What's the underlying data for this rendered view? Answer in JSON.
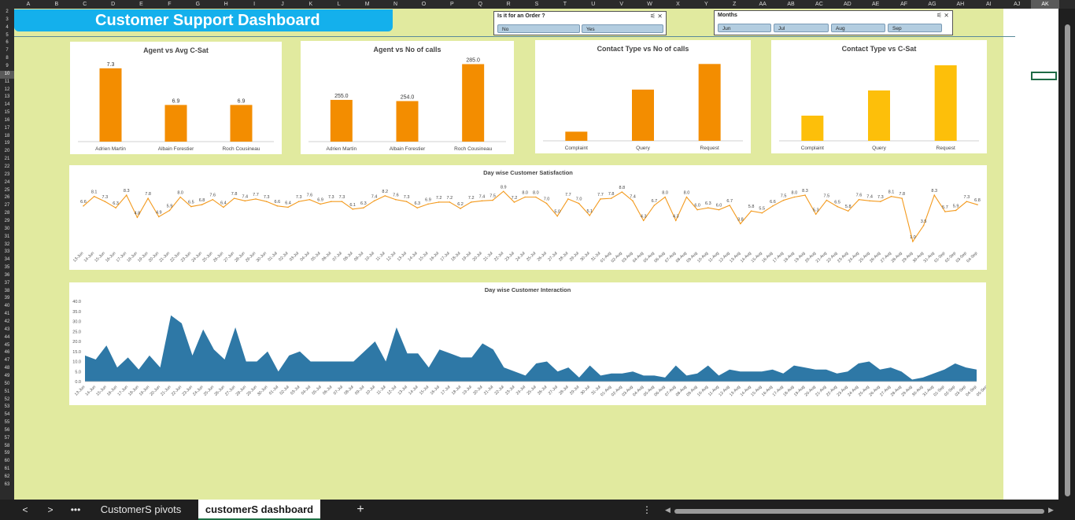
{
  "column_headers": [
    "A",
    "B",
    "C",
    "D",
    "E",
    "F",
    "G",
    "H",
    "I",
    "J",
    "K",
    "L",
    "M",
    "N",
    "O",
    "P",
    "Q",
    "R",
    "S",
    "T",
    "U",
    "V",
    "W",
    "X",
    "Y",
    "Z",
    "AA",
    "AB",
    "AC",
    "AD",
    "AE",
    "AF",
    "AG",
    "AH",
    "AI",
    "AJ",
    "AK"
  ],
  "selected_column": "AK",
  "row_headers": [
    "2",
    "3",
    "4",
    "5",
    "6",
    "7",
    "8",
    "9",
    "10",
    "11",
    "12",
    "13",
    "14",
    "15",
    "16",
    "17",
    "18",
    "19",
    "20",
    "21",
    "22",
    "23",
    "24",
    "25",
    "26",
    "27",
    "28",
    "29",
    "30",
    "31",
    "32",
    "33",
    "34",
    "35",
    "36",
    "37",
    "38",
    "39",
    "40",
    "41",
    "42",
    "43",
    "44",
    "45",
    "46",
    "47",
    "48",
    "49",
    "50",
    "51",
    "52",
    "53",
    "54",
    "55",
    "56",
    "57",
    "58",
    "59",
    "60",
    "61",
    "62",
    "63"
  ],
  "selected_row": "10",
  "dashboard": {
    "title": "Customer Support Dashboard"
  },
  "slicers": {
    "order": {
      "title": "Is it for an Order ?",
      "items": [
        "No",
        "Yes"
      ]
    },
    "months": {
      "title": "Months",
      "items": [
        "Jun",
        "Jul",
        "Aug",
        "Sep"
      ]
    }
  },
  "colors": {
    "sheet_bg": "#e1ea9f",
    "banner": "#14b0ec",
    "orange": "#f38d00",
    "yellow": "#fdbf0a",
    "area": "#2e78a6",
    "line": "#f39a1e"
  },
  "chart_data": [
    {
      "id": "agent-csat",
      "type": "bar",
      "title": "Agent vs Avg C-Sat",
      "categories": [
        "Adrien Martin",
        "Albain Forestier",
        "Roch Cousineau"
      ],
      "values": [
        7.3,
        6.9,
        6.9
      ],
      "labels": [
        "7.3",
        "6.9",
        "6.9"
      ],
      "ylim": [
        6.5,
        7.35
      ],
      "color": "#f38d00",
      "show_labels": true
    },
    {
      "id": "agent-calls",
      "type": "bar",
      "title": "Agent vs No of calls",
      "categories": [
        "Adrien Martin",
        "Albain Forestier",
        "Roch Cousineau"
      ],
      "values": [
        255,
        254,
        285
      ],
      "labels": [
        "255.0",
        "254.0",
        "285.0"
      ],
      "ylim": [
        220,
        286
      ],
      "color": "#f38d00",
      "show_labels": true
    },
    {
      "id": "contact-calls",
      "type": "bar",
      "title": "Contact Type vs No of calls",
      "categories": [
        "Complaint",
        "Query",
        "Request"
      ],
      "values": [
        120,
        350,
        490
      ],
      "labels": [],
      "ylim": [
        70,
        500
      ],
      "color": "#f38d00",
      "show_labels": false
    },
    {
      "id": "contact-csat",
      "type": "bar",
      "title": "Contact Type vs C-Sat",
      "categories": [
        "Complaint",
        "Query",
        "Request"
      ],
      "values": [
        6.6,
        7.0,
        7.4
      ],
      "labels": [],
      "ylim": [
        6.2,
        7.45
      ],
      "color": "#fdbf0a",
      "show_labels": false
    },
    {
      "id": "daily-csat",
      "type": "line",
      "title": "Day wise Customer Satisfaction",
      "categories": [
        "13-Jun",
        "14-Jun",
        "15-Jun",
        "16-Jun",
        "17-Jun",
        "18-Jun",
        "19-Jun",
        "20-Jun",
        "21-Jun",
        "22-Jun",
        "23-Jun",
        "24-Jun",
        "25-Jun",
        "26-Jun",
        "27-Jun",
        "28-Jun",
        "29-Jun",
        "30-Jun",
        "01-Jul",
        "02-Jul",
        "03-Jul",
        "04-Jul",
        "05-Jul",
        "06-Jul",
        "07-Jul",
        "08-Jul",
        "09-Jul",
        "10-Jul",
        "11-Jul",
        "12-Jul",
        "13-Jul",
        "14-Jul",
        "15-Jul",
        "16-Jul",
        "17-Jul",
        "18-Jul",
        "19-Jul",
        "20-Jul",
        "21-Jul",
        "22-Jul",
        "23-Jul",
        "24-Jul",
        "25-Jul",
        "26-Jul",
        "27-Jul",
        "28-Jul",
        "29-Jul",
        "30-Jul",
        "31-Jul",
        "01-Aug",
        "02-Aug",
        "03-Aug",
        "04-Aug",
        "05-Aug",
        "06-Aug",
        "07-Aug",
        "08-Aug",
        "09-Aug",
        "10-Aug",
        "11-Aug",
        "12-Aug",
        "13-Aug",
        "14-Aug",
        "15-Aug",
        "16-Aug",
        "17-Aug",
        "18-Aug",
        "19-Aug",
        "20-Aug",
        "21-Aug",
        "22-Aug",
        "23-Aug",
        "24-Aug",
        "25-Aug",
        "26-Aug",
        "27-Aug",
        "28-Aug",
        "29-Aug",
        "30-Aug",
        "31-Aug",
        "01-Sep",
        "02-Sep",
        "03-Sep",
        "04-Sep",
        "05-Sep",
        "06-Sep"
      ],
      "values": [
        6.6,
        8.1,
        7.3,
        6.3,
        8.3,
        4.8,
        7.8,
        4.9,
        5.9,
        8.0,
        6.5,
        6.8,
        7.6,
        6.4,
        7.8,
        7.4,
        7.7,
        7.3,
        6.6,
        6.4,
        7.3,
        7.6,
        6.9,
        7.3,
        7.3,
        6.1,
        6.3,
        7.4,
        8.2,
        7.6,
        7.3,
        6.3,
        6.9,
        7.2,
        7.2,
        6.2,
        7.2,
        7.4,
        7.5,
        8.9,
        7.2,
        8.0,
        8.0,
        7.0,
        5.0,
        7.7,
        7.0,
        5.1,
        7.7,
        7.8,
        8.8,
        7.4,
        4.3,
        6.7,
        8.0,
        4.3,
        8.0,
        6.0,
        6.3,
        6.0,
        6.7,
        3.8,
        5.8,
        5.5,
        6.6,
        7.5,
        8.0,
        8.3,
        5.3,
        7.5,
        6.5,
        5.8,
        7.6,
        7.4,
        7.3,
        8.1,
        7.8,
        1.0,
        3.5,
        8.3,
        5.7,
        5.9,
        7.3,
        6.8
      ],
      "ylim": [
        0,
        9.8
      ],
      "color": "#f39a1e"
    },
    {
      "id": "daily-interaction",
      "type": "area",
      "title": "Day wise Customer Interaction",
      "categories": [
        "13-Jun",
        "14-Jun",
        "15-Jun",
        "16-Jun",
        "17-Jun",
        "18-Jun",
        "19-Jun",
        "20-Jun",
        "21-Jun",
        "22-Jun",
        "23-Jun",
        "24-Jun",
        "25-Jun",
        "26-Jun",
        "27-Jun",
        "28-Jun",
        "29-Jun",
        "30-Jun",
        "01-Jul",
        "02-Jul",
        "03-Jul",
        "04-Jul",
        "05-Jul",
        "06-Jul",
        "07-Jul",
        "08-Jul",
        "09-Jul",
        "10-Jul",
        "11-Jul",
        "12-Jul",
        "13-Jul",
        "14-Jul",
        "15-Jul",
        "16-Jul",
        "17-Jul",
        "18-Jul",
        "19-Jul",
        "20-Jul",
        "21-Jul",
        "22-Jul",
        "23-Jul",
        "24-Jul",
        "25-Jul",
        "26-Jul",
        "27-Jul",
        "28-Jul",
        "29-Jul",
        "30-Jul",
        "31-Jul",
        "01-Aug",
        "02-Aug",
        "03-Aug",
        "04-Aug",
        "05-Aug",
        "06-Aug",
        "07-Aug",
        "08-Aug",
        "09-Aug",
        "10-Aug",
        "11-Aug",
        "12-Aug",
        "13-Aug",
        "14-Aug",
        "15-Aug",
        "16-Aug",
        "17-Aug",
        "18-Aug",
        "19-Aug",
        "20-Aug",
        "21-Aug",
        "22-Aug",
        "23-Aug",
        "24-Aug",
        "25-Aug",
        "26-Aug",
        "27-Aug",
        "28-Aug",
        "29-Aug",
        "30-Aug",
        "31-Aug",
        "01-Sep",
        "02-Sep",
        "03-Sep",
        "04-Sep",
        "05-Sep",
        "06-Sep",
        "07-Sep",
        "08-Sep"
      ],
      "values": [
        13,
        11,
        18,
        7,
        12,
        6,
        13,
        7,
        33,
        29,
        13,
        26,
        16,
        11,
        27,
        10,
        10,
        15,
        5,
        13,
        15,
        10,
        10,
        10,
        10,
        10,
        15,
        20,
        10,
        27,
        14,
        14,
        7,
        16,
        14,
        12,
        12,
        19,
        16,
        7,
        5,
        3,
        9,
        10,
        5,
        7,
        2,
        8,
        3,
        4,
        4,
        5,
        3,
        3,
        2,
        8,
        3,
        4,
        8,
        3,
        6,
        5,
        5,
        5,
        6,
        4,
        8,
        7,
        6,
        6,
        4,
        5,
        9,
        10,
        6,
        7,
        5,
        1,
        2,
        4,
        6,
        9,
        7,
        6
      ],
      "yticks": [
        "0.0",
        "5.0",
        "10.0",
        "15.0",
        "20.0",
        "25.0",
        "30.0",
        "35.0",
        "40.0"
      ],
      "ylim": [
        0,
        40
      ],
      "color": "#2e78a6"
    }
  ],
  "tabs": {
    "prev": "<",
    "next": ">",
    "more": "•••",
    "items": [
      "CustomerS pivots",
      "customerS dashboard"
    ],
    "active": "customerS dashboard",
    "add": "+",
    "options": "⋮"
  }
}
